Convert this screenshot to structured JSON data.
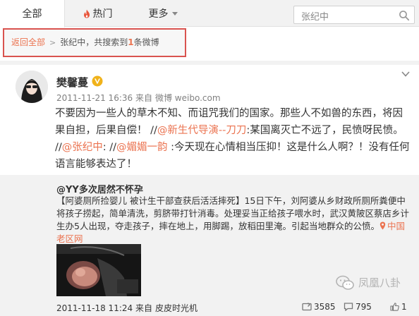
{
  "tabs": [
    {
      "label": "全部",
      "active": true
    },
    {
      "label": "热门"
    },
    {
      "label": "更多"
    }
  ],
  "search": {
    "value": "张纪中"
  },
  "breadcrumb": {
    "back_label": "返回全部",
    "query": "张纪中",
    "summary_prefix": "，共搜索到",
    "count": "1",
    "summary_suffix": "条微博"
  },
  "post": {
    "username": "樊馨蔓",
    "time": "2011-11-21 16:36",
    "via_prefix": "来自",
    "via": "微博 weibo.com",
    "content_parts": [
      "不要因为一些人的草木不知、而诅咒我们的国家。那些人不如兽的东西，将因果自担，后果自偿！ //",
      "@新生代导演--刀刀",
      ":某国离灭亡不远了，民愤呀民愤。 //",
      "@张纪中",
      ": //",
      "@媚媚一韵",
      " :今天现在心情相当压抑！这是什么人啊？！没有任何语言能够表达了！"
    ]
  },
  "repost": {
    "author": "@YY多次居然不怀孕",
    "text": "【阿婆厕所捡婴儿 被计生干部查获后活活摔死】15日下午，刘阿婆从乡财政所厕所粪便中将孩子捞起，简单清洗，剪脐带打针消毒。处理妥当正给孩子喂水时，武汉黄陂区蔡店乡计生办5人出现，夺走孩子，摔在地上，用脚踢，放稻田里淹。引起当地群众的公愤。",
    "location": "中国老区网",
    "time": "2011-11-18 11:24",
    "via_prefix": "来自",
    "via": "皮皮时光机",
    "reposts": "3585",
    "comments": "795",
    "likes": "1"
  },
  "watermark": {
    "text": "凤凰八卦"
  },
  "colors": {
    "accent": "#eb7350",
    "highlight_border": "#d9534f",
    "verified": "#f0b21a"
  }
}
